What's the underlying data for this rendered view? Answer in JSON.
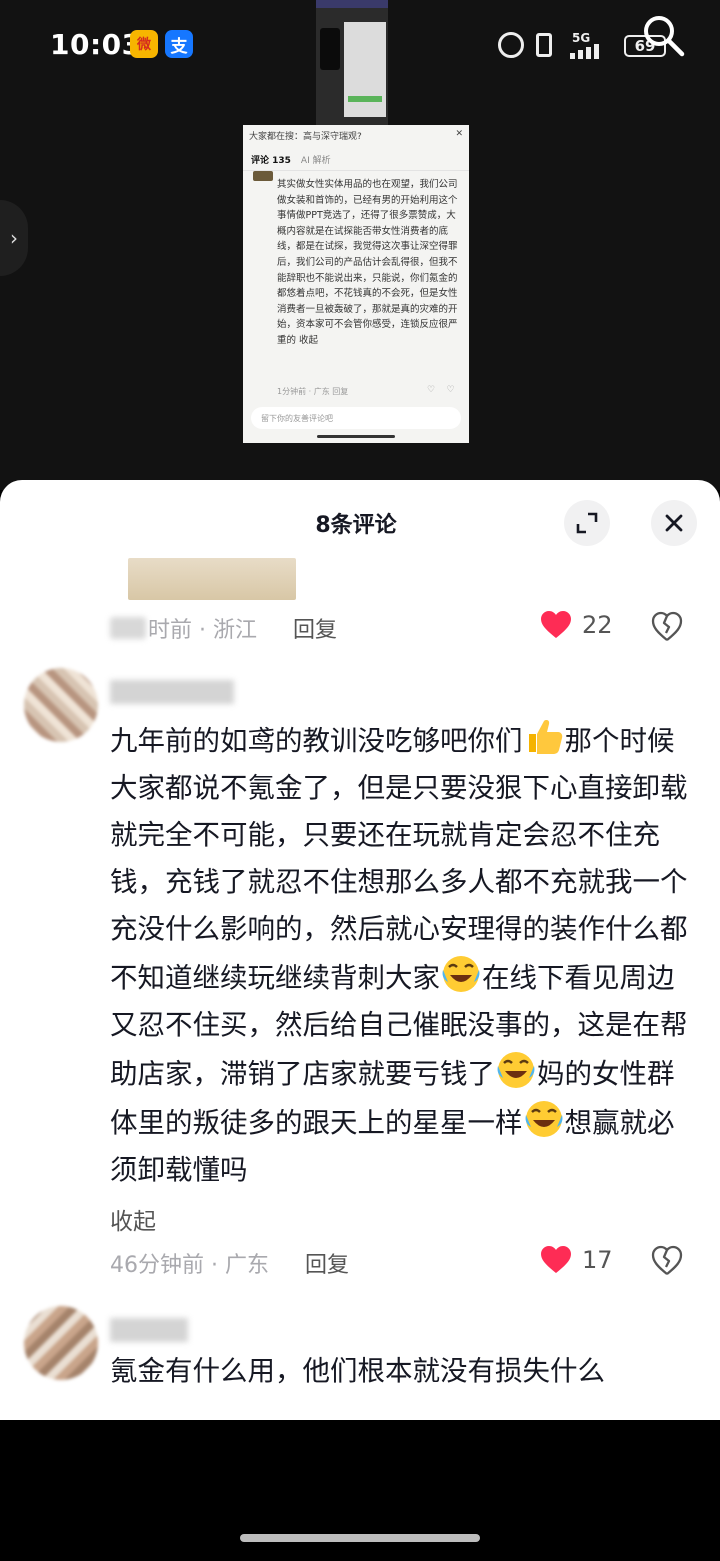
{
  "status_bar": {
    "time": "10:03",
    "weibo_glyph": "微",
    "alipay_glyph": "支",
    "network": "5G",
    "battery": "69"
  },
  "video": {
    "screenshot": {
      "header_text": "大家都在搜：高与深守瑞观?",
      "tab_comments": "评论 135",
      "tab_ai": "AI 解析",
      "body": "其实做女性实体用品的也在观望，我们公司做女装和首饰的，已经有男的开始利用这个事情做PPT竞选了，还得了很多票赞成，大概内容就是在试探能否带女性消费者的底线，都是在试探，我觉得这次事让深空得罪后，我们公司的产品估计会乱得很，但我不能辞职也不能说出来，只能说，你们氪金的都悠着点吧，不花钱真的不会死，但是女性消费者一旦被轰破了，那就是真的灾难的开始，资本家可不会管你感受，连锁反应很严重的 收起",
      "meta": "1分钟前 · 广东    回复",
      "input_placeholder": "留下你的友善评论吧"
    }
  },
  "panel": {
    "title": "8条评论"
  },
  "comments": [
    {
      "time": "时前 · 浙江",
      "reply": "回复",
      "likes": "22"
    },
    {
      "text_1": "九年前的如鸢的教训没吃够吧你们",
      "text_2": "那个时候大家都说不氪金了，但是只要没狠下心直接卸载就完全不可能，只要还在玩就肯定会忍不住充钱，充钱了就忍不住想那么多人都不充就我一个充没什么影响的，然后就心安理得的装作什么都不知道继续玩继续背刺大家",
      "text_3": "在线下看见周边又忍不住买，然后给自己催眠没事的，这是在帮助店家，滞销了店家就要亏钱了",
      "text_4": "妈的女性群体里的叛徒多的跟天上的星星一样",
      "text_5": "想赢就必须卸载懂吗",
      "collapse": "收起",
      "time": "46分钟前 · 广东",
      "reply": "回复",
      "likes": "17"
    },
    {
      "text": "氪金有什么用，他们根本就没有损失什么"
    }
  ],
  "icons": {
    "heart": "heart-icon",
    "dislike": "broken-heart-icon",
    "close": "close-icon",
    "expand": "expand-icon",
    "search": "search-icon",
    "emoji_thumbs_up": "thumbs-up-emoji",
    "emoji_laugh_cry": "laugh-cry-emoji"
  },
  "colors": {
    "like_red": "#fe2c55",
    "text_primary": "#161823",
    "text_secondary": "#a9a9ae"
  }
}
